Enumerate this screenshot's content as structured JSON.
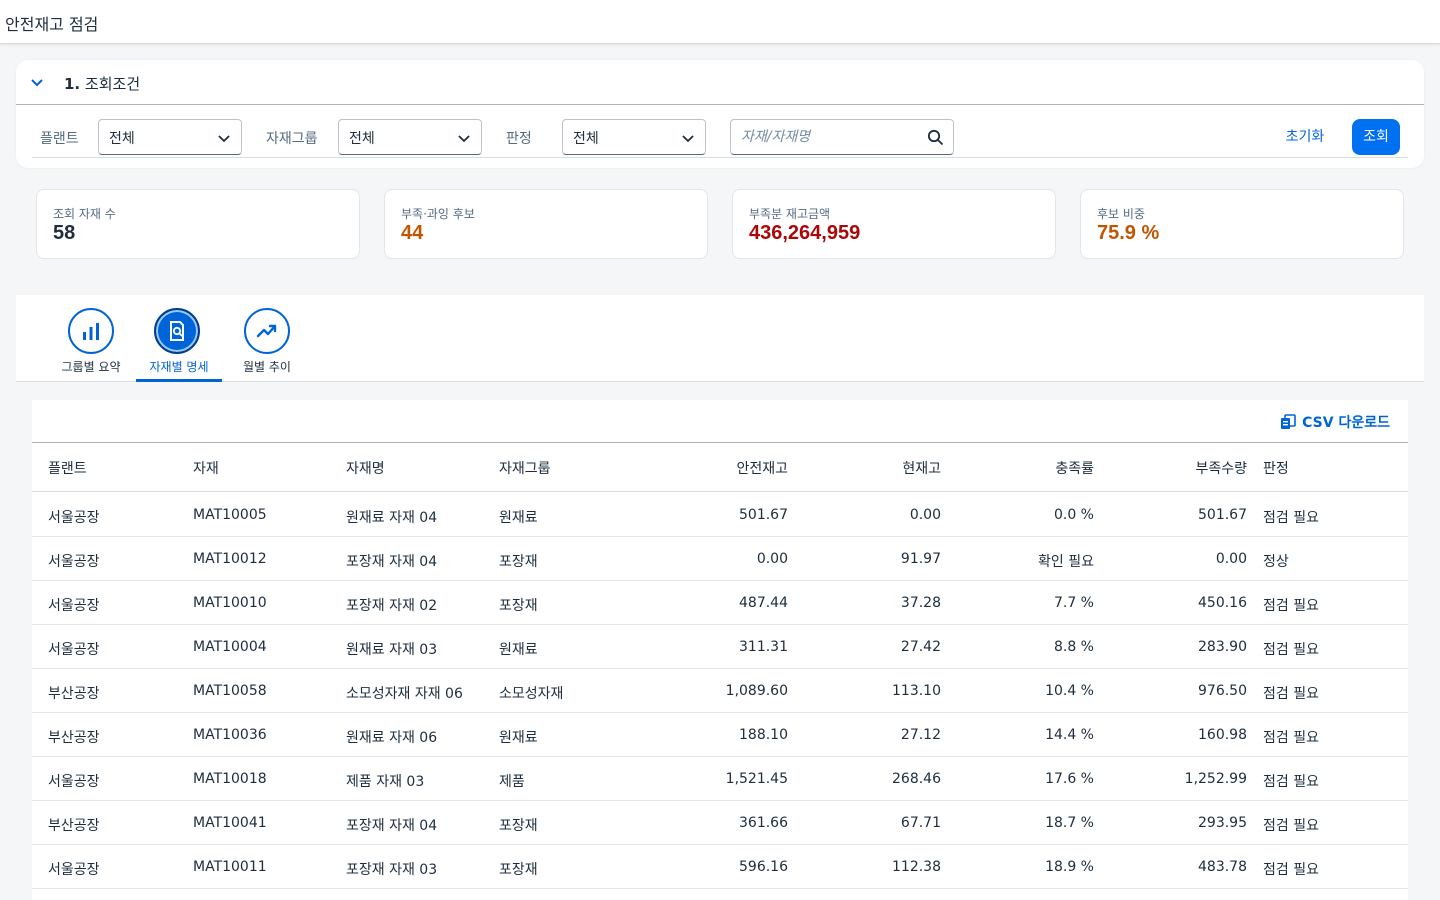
{
  "app": {
    "title": "안전재고 점검"
  },
  "filter": {
    "section_number": "1.",
    "section_title": "조회조건",
    "plant_label": "플랜트",
    "plant_value": "전체",
    "group_label": "자재그룹",
    "group_value": "전체",
    "judge_label": "판정",
    "judge_value": "전체",
    "search_placeholder": "자재/자재명",
    "reset_label": "초기화",
    "search_label": "조회"
  },
  "kpis": [
    {
      "label": "조회 자재 수",
      "value": "58",
      "color": "#1d2d3e"
    },
    {
      "label": "부족·과잉 후보",
      "value": "44",
      "color": "#c35500"
    },
    {
      "label": "부족분 재고금액",
      "value": "436,264,959",
      "color": "#aa0808"
    },
    {
      "label": "후보 비중",
      "value": "75.9 %",
      "color": "#c35500"
    }
  ],
  "tabs": [
    {
      "label": "그룹별 요약",
      "icon": "bar-chart-icon",
      "active": false
    },
    {
      "label": "자재별 명세",
      "icon": "document-search-icon",
      "active": true
    },
    {
      "label": "월별 추이",
      "icon": "trend-up-icon",
      "active": false
    }
  ],
  "table": {
    "csv_label": "CSV 다운로드",
    "columns": [
      "플랜트",
      "자재",
      "자재명",
      "자재그룹",
      "안전재고",
      "현재고",
      "충족률",
      "부족수량",
      "판정"
    ],
    "rows": [
      [
        "서울공장",
        "MAT10005",
        "원재료 자재 04",
        "원재료",
        "501.67",
        "0.00",
        "0.0 %",
        "501.67",
        "점검 필요"
      ],
      [
        "서울공장",
        "MAT10012",
        "포장재 자재 04",
        "포장재",
        "0.00",
        "91.97",
        "확인 필요",
        "0.00",
        "정상"
      ],
      [
        "서울공장",
        "MAT10010",
        "포장재 자재 02",
        "포장재",
        "487.44",
        "37.28",
        "7.7 %",
        "450.16",
        "점검 필요"
      ],
      [
        "서울공장",
        "MAT10004",
        "원재료 자재 03",
        "원재료",
        "311.31",
        "27.42",
        "8.8 %",
        "283.90",
        "점검 필요"
      ],
      [
        "부산공장",
        "MAT10058",
        "소모성자재 자재 06",
        "소모성자재",
        "1,089.60",
        "113.10",
        "10.4 %",
        "976.50",
        "점검 필요"
      ],
      [
        "부산공장",
        "MAT10036",
        "원재료 자재 06",
        "원재료",
        "188.10",
        "27.12",
        "14.4 %",
        "160.98",
        "점검 필요"
      ],
      [
        "서울공장",
        "MAT10018",
        "제품 자재 03",
        "제품",
        "1,521.45",
        "268.46",
        "17.6 %",
        "1,252.99",
        "점검 필요"
      ],
      [
        "부산공장",
        "MAT10041",
        "포장재 자재 04",
        "포장재",
        "361.66",
        "67.71",
        "18.7 %",
        "293.95",
        "점검 필요"
      ],
      [
        "서울공장",
        "MAT10011",
        "포장재 자재 03",
        "포장재",
        "596.16",
        "112.38",
        "18.9 %",
        "483.78",
        "점검 필요"
      ]
    ]
  },
  "colors": {
    "accent": "#0064d9",
    "primary_button": "#0070f2",
    "warning_text": "#aa0808"
  }
}
